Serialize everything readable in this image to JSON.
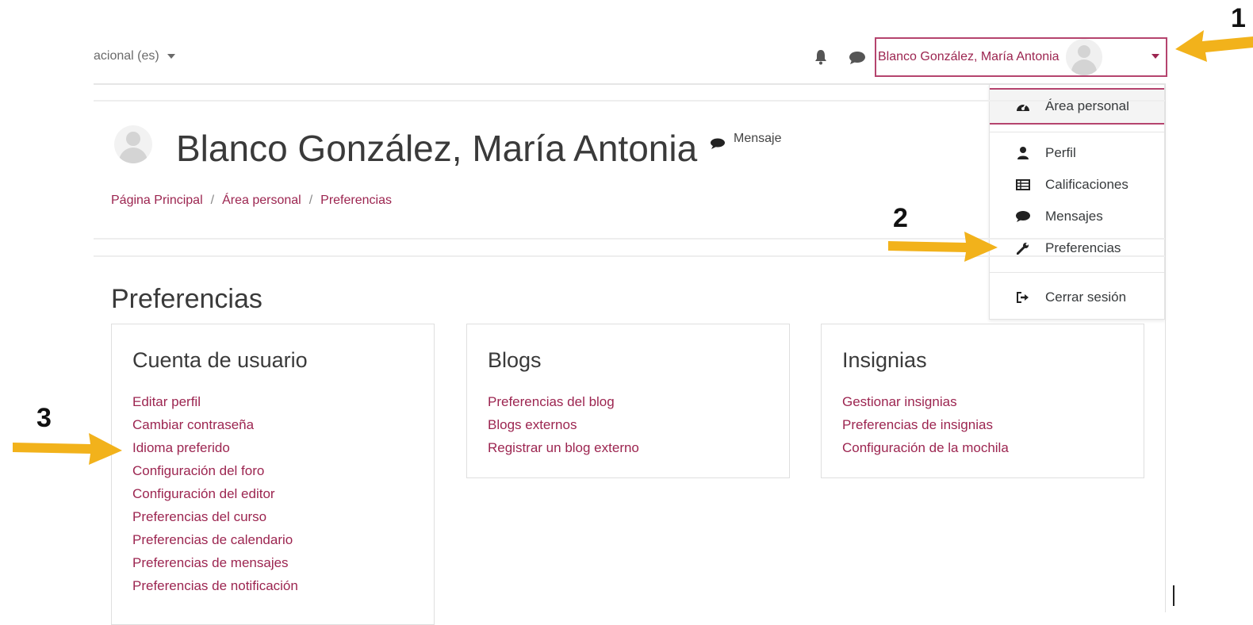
{
  "nav": {
    "language": "acional (es)",
    "user_name": "Blanco González, María Antonia"
  },
  "dropdown": {
    "items": [
      {
        "label": "Área personal",
        "icon": "dashboard-icon"
      },
      {
        "label": "Perfil",
        "icon": "user-icon"
      },
      {
        "label": "Calificaciones",
        "icon": "table-icon"
      },
      {
        "label": "Mensajes",
        "icon": "chat-icon"
      },
      {
        "label": "Preferencias",
        "icon": "wrench-icon"
      },
      {
        "label": "Cerrar sesión",
        "icon": "logout-icon"
      }
    ]
  },
  "header": {
    "title": "Blanco González, María Antonia",
    "message_label": "Mensaje",
    "breadcrumb": [
      "Página Principal",
      "Área personal",
      "Preferencias"
    ]
  },
  "main": {
    "title": "Preferencias",
    "cards": [
      {
        "title": "Cuenta de usuario",
        "links": [
          "Editar perfil",
          "Cambiar contraseña",
          "Idioma preferido",
          "Configuración del foro",
          "Configuración del editor",
          "Preferencias del curso",
          "Preferencias de calendario",
          "Preferencias de mensajes",
          "Preferencias de notificación"
        ]
      },
      {
        "title": "Blogs",
        "links": [
          "Preferencias del blog",
          "Blogs externos",
          "Registrar un blog externo"
        ]
      },
      {
        "title": "Insignias",
        "links": [
          "Gestionar insignias",
          "Preferencias de insignias",
          "Configuración de la mochila"
        ]
      }
    ]
  },
  "annotations": {
    "n1": "1",
    "n2": "2",
    "n3": "3",
    "arrow_color": "#f2b21b"
  },
  "colors": {
    "link": "#9c2550",
    "highlight_border": "#b5446e"
  }
}
